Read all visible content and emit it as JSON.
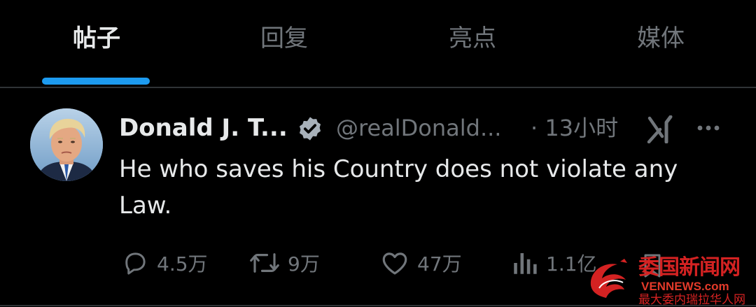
{
  "tabs": [
    {
      "label": "帖子",
      "active": true
    },
    {
      "label": "回复",
      "active": false
    },
    {
      "label": "亮点",
      "active": false
    },
    {
      "label": "媒体",
      "active": false
    }
  ],
  "post": {
    "author_name": "Donald J. T...",
    "verified": true,
    "handle": "@realDonald...",
    "time": "· 13小时",
    "text": "He who saves his Country does not violate any Law.",
    "avatar_icon": "avatar-photo",
    "actions": {
      "reply": {
        "icon": "reply-bubble-icon",
        "count": "4.5万"
      },
      "repost": {
        "icon": "repost-arrows-icon",
        "count": "9万"
      },
      "like": {
        "icon": "heart-icon",
        "count": "47万"
      },
      "views": {
        "icon": "views-bars-icon",
        "count": "1.1亿"
      },
      "bookmark": {
        "icon": "bookmark-icon"
      }
    }
  },
  "watermark": {
    "title": "委国新闻网",
    "domain": "VENNEWS.com",
    "subtitle": "最大委内瑞拉华人网"
  },
  "colors": {
    "background": "#000000",
    "text_primary": "#e7e9ea",
    "text_secondary": "#71767b",
    "accent": "#1d9bf0",
    "divider": "#2f3336",
    "watermark_red": "#d42222"
  }
}
